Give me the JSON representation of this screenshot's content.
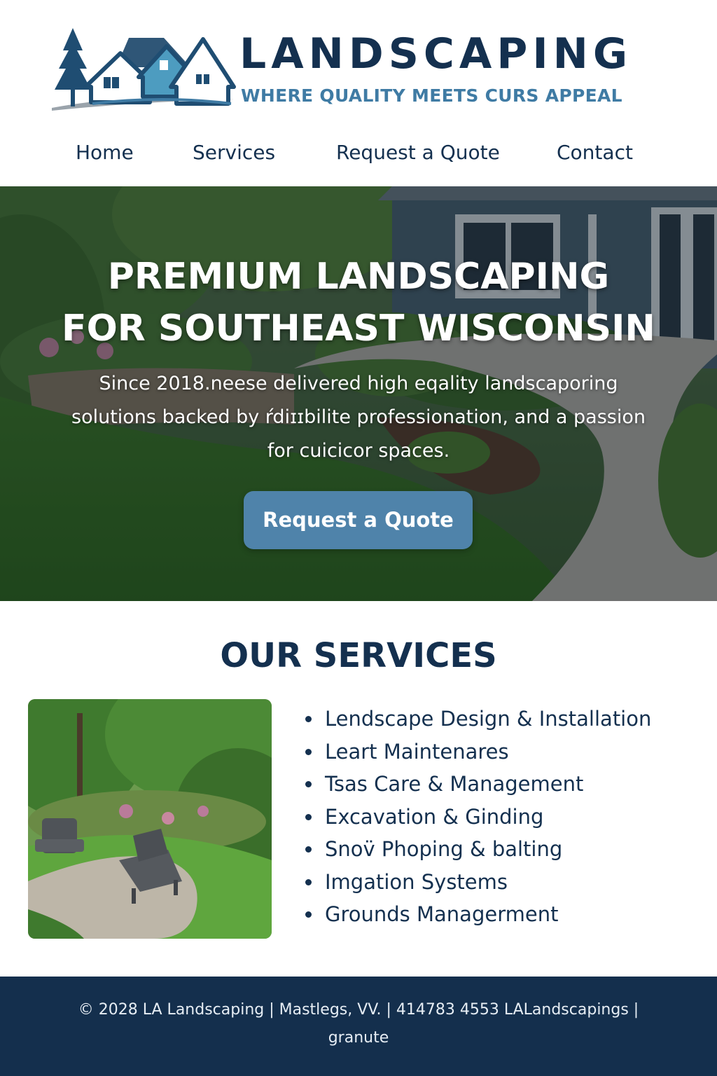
{
  "brand": {
    "name": "LANDSCAPING",
    "tagline": "WHERE QUALITY MEETS CURS APPEAL"
  },
  "nav": {
    "items": [
      {
        "label": "Home"
      },
      {
        "label": "Services"
      },
      {
        "label": "Request a Quote"
      },
      {
        "label": "Contact"
      }
    ]
  },
  "hero": {
    "title_line1": "PREMIUM LANDSCAPING",
    "title_line2": "FOR SOUTHEAST WISCONSIN",
    "text": "Since 2018.neese delivered high eqality landscaporing solutions backed by ŕdiɪɪbilite professionation, and a passion for cuicicor spaces.",
    "button_label": "Request a Quote"
  },
  "services": {
    "heading": "OUR SERVICES",
    "items": [
      "Lendscape Design & Installation",
      "Leart Maintenares",
      "Tsas Care & Management",
      "Excavation & Ginding",
      "Snov̈ Phoping & balting",
      "Imgation Systems",
      "Grounds Managerment"
    ]
  },
  "footer": {
    "text": "© 2028 LA Landscaping  |  Mastlegs, VV.  |  414783 4553   LALandscapings | granute"
  },
  "colors": {
    "navy": "#14304f",
    "accent_blue": "#4f83aa",
    "tagline_blue": "#3f7ba4",
    "footer_bg": "#142f4d"
  }
}
